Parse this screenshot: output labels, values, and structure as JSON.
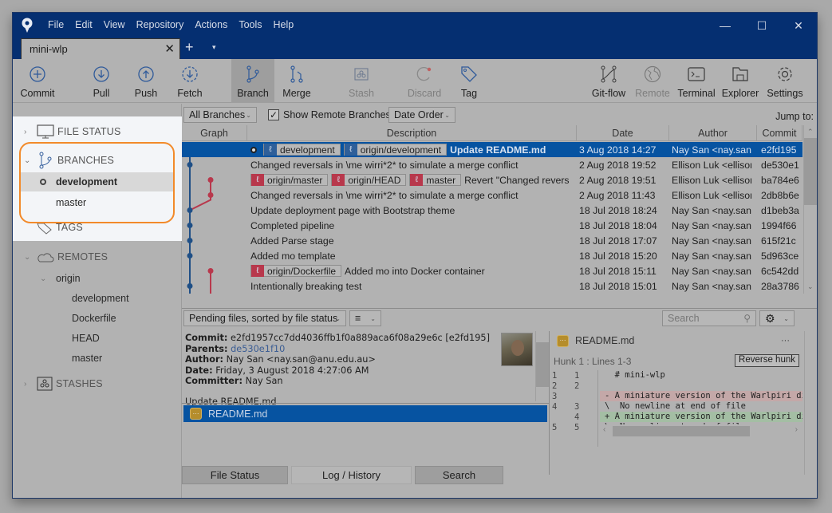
{
  "window": {
    "menu": [
      "File",
      "Edit",
      "View",
      "Repository",
      "Actions",
      "Tools",
      "Help"
    ],
    "controls": {
      "minimize": "—",
      "maximize": "☐",
      "close": "✕"
    },
    "tab": {
      "label": "mini-wlp",
      "close": "✕"
    },
    "new_tab": "+",
    "tab_menu": "▾"
  },
  "toolbar": {
    "commit": "Commit",
    "pull": "Pull",
    "push": "Push",
    "fetch": "Fetch",
    "branch": "Branch",
    "merge": "Merge",
    "stash": "Stash",
    "discard": "Discard",
    "tag": "Tag",
    "gitflow": "Git-flow",
    "remote": "Remote",
    "terminal": "Terminal",
    "explorer": "Explorer",
    "settings": "Settings"
  },
  "sidebar": {
    "file_status": "FILE STATUS",
    "branches": "BRANCHES",
    "branch_items": [
      "development",
      "master"
    ],
    "tags": "TAGS",
    "remotes": "REMOTES",
    "remote_name": "origin",
    "remote_branches": [
      "development",
      "Dockerfile",
      "HEAD",
      "master"
    ],
    "stashes": "STASHES"
  },
  "filter": {
    "branches": "All Branches",
    "show_remote": "Show Remote Branches",
    "show_remote_checked": true,
    "order": "Date Order",
    "jump": "Jump to:"
  },
  "columns": {
    "graph": "Graph",
    "description": "Description",
    "date": "Date",
    "author": "Author",
    "commit": "Commit"
  },
  "commits": [
    {
      "badges": [
        {
          "label": "development",
          "color": "blue"
        },
        {
          "label": "origin/development",
          "color": "blue"
        }
      ],
      "current": true,
      "message": "Update README.md",
      "date": "3 Aug 2018 14:27",
      "author": "Nay San <nay.san@",
      "hash": "e2fd195"
    },
    {
      "badges": [],
      "message": "Changed reversals in \\me wirri*2* to simulate a merge conflict",
      "date": "2 Aug 2018 19:52",
      "author": "Ellison Luk <ellison",
      "hash": "de530e1"
    },
    {
      "badges": [
        {
          "label": "origin/master",
          "color": "red"
        },
        {
          "label": "origin/HEAD",
          "color": "red"
        },
        {
          "label": "master",
          "color": "red"
        }
      ],
      "message": "Revert \"Changed revers",
      "date": "2 Aug 2018 19:51",
      "author": "Ellison Luk <ellison",
      "hash": "ba784e6"
    },
    {
      "badges": [],
      "message": "Changed reversals in \\me wirri*2* to simulate a merge conflict",
      "date": "2 Aug 2018 11:43",
      "author": "Ellison Luk <ellison",
      "hash": "2db8b6e"
    },
    {
      "badges": [],
      "message": "Update deployment page with Bootstrap theme",
      "date": "18 Jul 2018 18:24",
      "author": "Nay San <nay.san@",
      "hash": "d1beb3a"
    },
    {
      "badges": [],
      "message": "Completed pipeline",
      "date": "18 Jul 2018 18:04",
      "author": "Nay San <nay.san@",
      "hash": "1994f66"
    },
    {
      "badges": [],
      "message": "Added Parse stage",
      "date": "18 Jul 2018 17:07",
      "author": "Nay San <nay.san@",
      "hash": "615f21c"
    },
    {
      "badges": [],
      "message": "Added mo template",
      "date": "18 Jul 2018 15:20",
      "author": "Nay San <nay.san@",
      "hash": "5d963ce"
    },
    {
      "badges": [
        {
          "label": "origin/Dockerfile",
          "color": "red"
        }
      ],
      "message": "Added mo into Docker container",
      "date": "18 Jul 2018 15:11",
      "author": "Nay San <nay.san@",
      "hash": "6c542dd"
    },
    {
      "badges": [],
      "message": "Intentionally breaking test",
      "date": "18 Jul 2018 15:01",
      "author": "Nay San <nay.san@",
      "hash": "28a3786"
    }
  ],
  "lower": {
    "pending_dropdown": "Pending files, sorted by file status",
    "view_menu": "≡",
    "search_placeholder": "Search"
  },
  "details": {
    "commit_label": "Commit:",
    "commit_value": "e2fd1957cc7dd4036ffb1f0a889aca6f08a29e6c [e2fd195]",
    "parents_label": "Parents:",
    "parents_value": "de530e1f10",
    "author_label": "Author:",
    "author_value": "Nay San <nay.san@anu.edu.au>",
    "date_label": "Date:",
    "date_value": "Friday, 3 August 2018 4:27:06 AM",
    "committer_label": "Committer:",
    "committer_value": "Nay San",
    "message": "Update README.md"
  },
  "files": [
    {
      "name": "README.md",
      "status": "modified"
    }
  ],
  "diff": {
    "file": "README.md",
    "more": "···",
    "hunk": "Hunk 1 : Lines 1-3",
    "reverse": "Reverse hunk",
    "lines": [
      {
        "old": "1",
        "new": "1",
        "type": "ctx",
        "text": "  # mini-wlp"
      },
      {
        "old": "2",
        "new": "2",
        "type": "ctx",
        "text": ""
      },
      {
        "old": "3",
        "new": "",
        "type": "del",
        "text": "- A miniature version of the Warlpiri dictionary"
      },
      {
        "old": "4",
        "new": "3",
        "type": "ctx",
        "text": "\\  No newline at end of file"
      },
      {
        "old": "",
        "new": "4",
        "type": "add",
        "text": "+ A miniature version of the Warlpiri dictionary"
      },
      {
        "old": "5",
        "new": "5",
        "type": "ctx",
        "text": "\\  No newline at end of file"
      }
    ]
  },
  "bottom_tabs": [
    {
      "label": "File Status",
      "active": false
    },
    {
      "label": "Log / History",
      "active": true
    },
    {
      "label": "Search",
      "active": false
    }
  ],
  "colors": {
    "titlebar": "#052f71",
    "selection": "#0653a1",
    "branch_blue": "#2f5f99",
    "branch_red": "#b8384c",
    "highlight_ring": "#f28a2a"
  }
}
